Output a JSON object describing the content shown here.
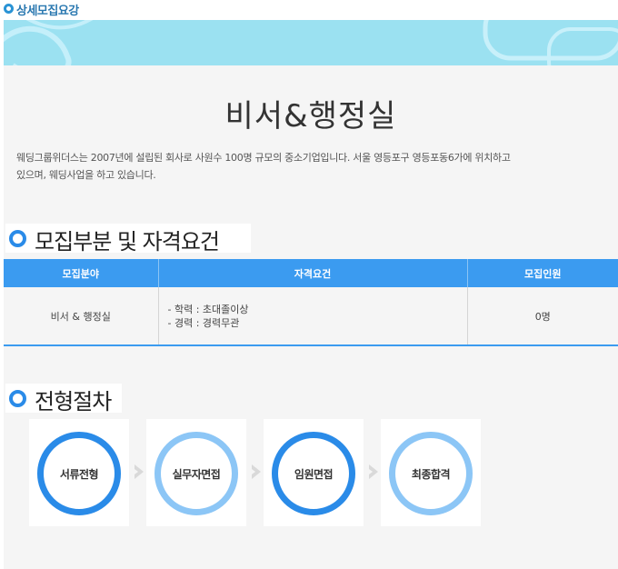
{
  "header": {
    "title": "상세모집요강"
  },
  "job": {
    "title": "비서&행정실",
    "description_line1": "웨딩그룹위더스는 2007년에 설립된 회사로 사원수 100명 규모의 중소기업입니다. 서울 영등포구 영등포동6가에 위치하고",
    "description_line2": "있으며, 웨딩사업을 하고 있습니다."
  },
  "section_requirements": {
    "title": "모집부분 및 자격요건"
  },
  "table": {
    "headers": [
      "모집분야",
      "자격요건",
      "모집인원"
    ],
    "row": {
      "field": "비서 & 행정실",
      "req_line1": "- 학력 : 초대졸이상",
      "req_line2": "- 경력 : 경력무관",
      "count": "0명"
    }
  },
  "section_process": {
    "title": "전형절차"
  },
  "steps": [
    "서류전형",
    "실무자면접",
    "임원면접",
    "최종합격"
  ],
  "colors": {
    "accent": "#2a8be8",
    "light_accent": "#8cc6f6",
    "table_header": "#3b9bf0",
    "banner": "#9be1f1"
  }
}
